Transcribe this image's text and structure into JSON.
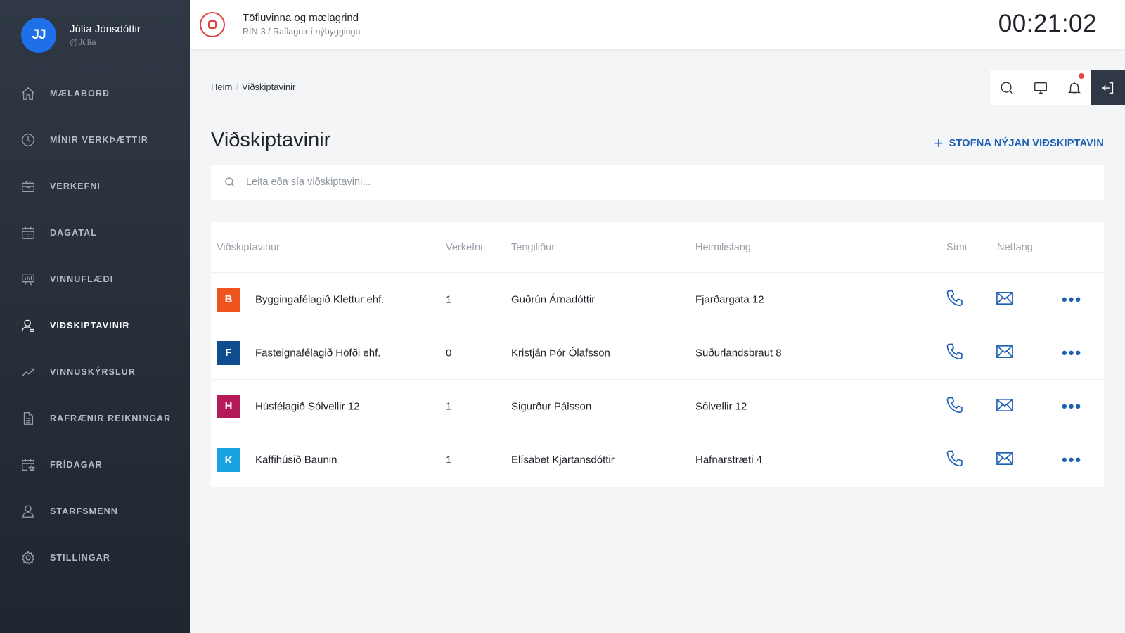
{
  "user": {
    "initials": "JJ",
    "name": "Júlía Jónsdóttir",
    "handle": "@Júlía"
  },
  "nav": [
    {
      "label": "MÆLABORÐ",
      "icon": "home-icon"
    },
    {
      "label": "MÍNIR VERKÞÆTTIR",
      "icon": "clock-icon"
    },
    {
      "label": "VERKEFNI",
      "icon": "briefcase-icon"
    },
    {
      "label": "DAGATAL",
      "icon": "calendar-icon"
    },
    {
      "label": "VINNUFLÆÐI",
      "icon": "presentation-icon"
    },
    {
      "label": "VIÐSKIPTAVINIR",
      "icon": "user-icon",
      "active": true
    },
    {
      "label": "VINNUSKÝRSLUR",
      "icon": "trend-icon"
    },
    {
      "label": "RAFRÆNIR REIKNINGAR",
      "icon": "document-icon"
    },
    {
      "label": "FRÍDAGAR",
      "icon": "calendar-star-icon"
    },
    {
      "label": "STARFSMENN",
      "icon": "users-icon"
    },
    {
      "label": "STILLINGAR",
      "icon": "gear-icon"
    }
  ],
  "topbar": {
    "task_title": "Töfluvinna og mælagrind",
    "task_subtitle": "RÍN-3 / Raflagnir í nýbyggingu",
    "timer": "00:21:02"
  },
  "breadcrumb": {
    "home": "Heim",
    "current": "Viðskiptavinir"
  },
  "page": {
    "title": "Viðskiptavinir",
    "new_button": "STOFNA NÝJAN VIÐSKIPTAVIN",
    "search_placeholder": "Leita eða sía viðskiptavini..."
  },
  "table": {
    "headers": {
      "customer": "Viðskiptavinur",
      "projects": "Verkefni",
      "contact": "Tengiliður",
      "address": "Heimilisfang",
      "phone": "Sími",
      "email": "Netfang"
    },
    "rows": [
      {
        "initial": "B",
        "color": "#f0541e",
        "name": "Byggingafélagið Klettur ehf.",
        "projects": "1",
        "contact": "Guðrún Árnadóttir",
        "address": "Fjarðargata 12"
      },
      {
        "initial": "F",
        "color": "#0f4d8f",
        "name": "Fasteignafélagið Höfði ehf.",
        "projects": "0",
        "contact": "Kristján Þór Ólafsson",
        "address": "Suðurlandsbraut 8"
      },
      {
        "initial": "H",
        "color": "#b51b58",
        "name": "Húsfélagið Sólvellir 12",
        "projects": "1",
        "contact": "Sigurður Pálsson",
        "address": "Sólvellir 12"
      },
      {
        "initial": "K",
        "color": "#1aa3e3",
        "name": "Kaffihúsið Baunin",
        "projects": "1",
        "contact": "Elísabet Kjartansdóttir",
        "address": "Hafnarstræti 4"
      }
    ]
  },
  "colors": {
    "accent": "#1d5fb4",
    "danger": "#e0413b",
    "sidebar": "#2f3844"
  }
}
